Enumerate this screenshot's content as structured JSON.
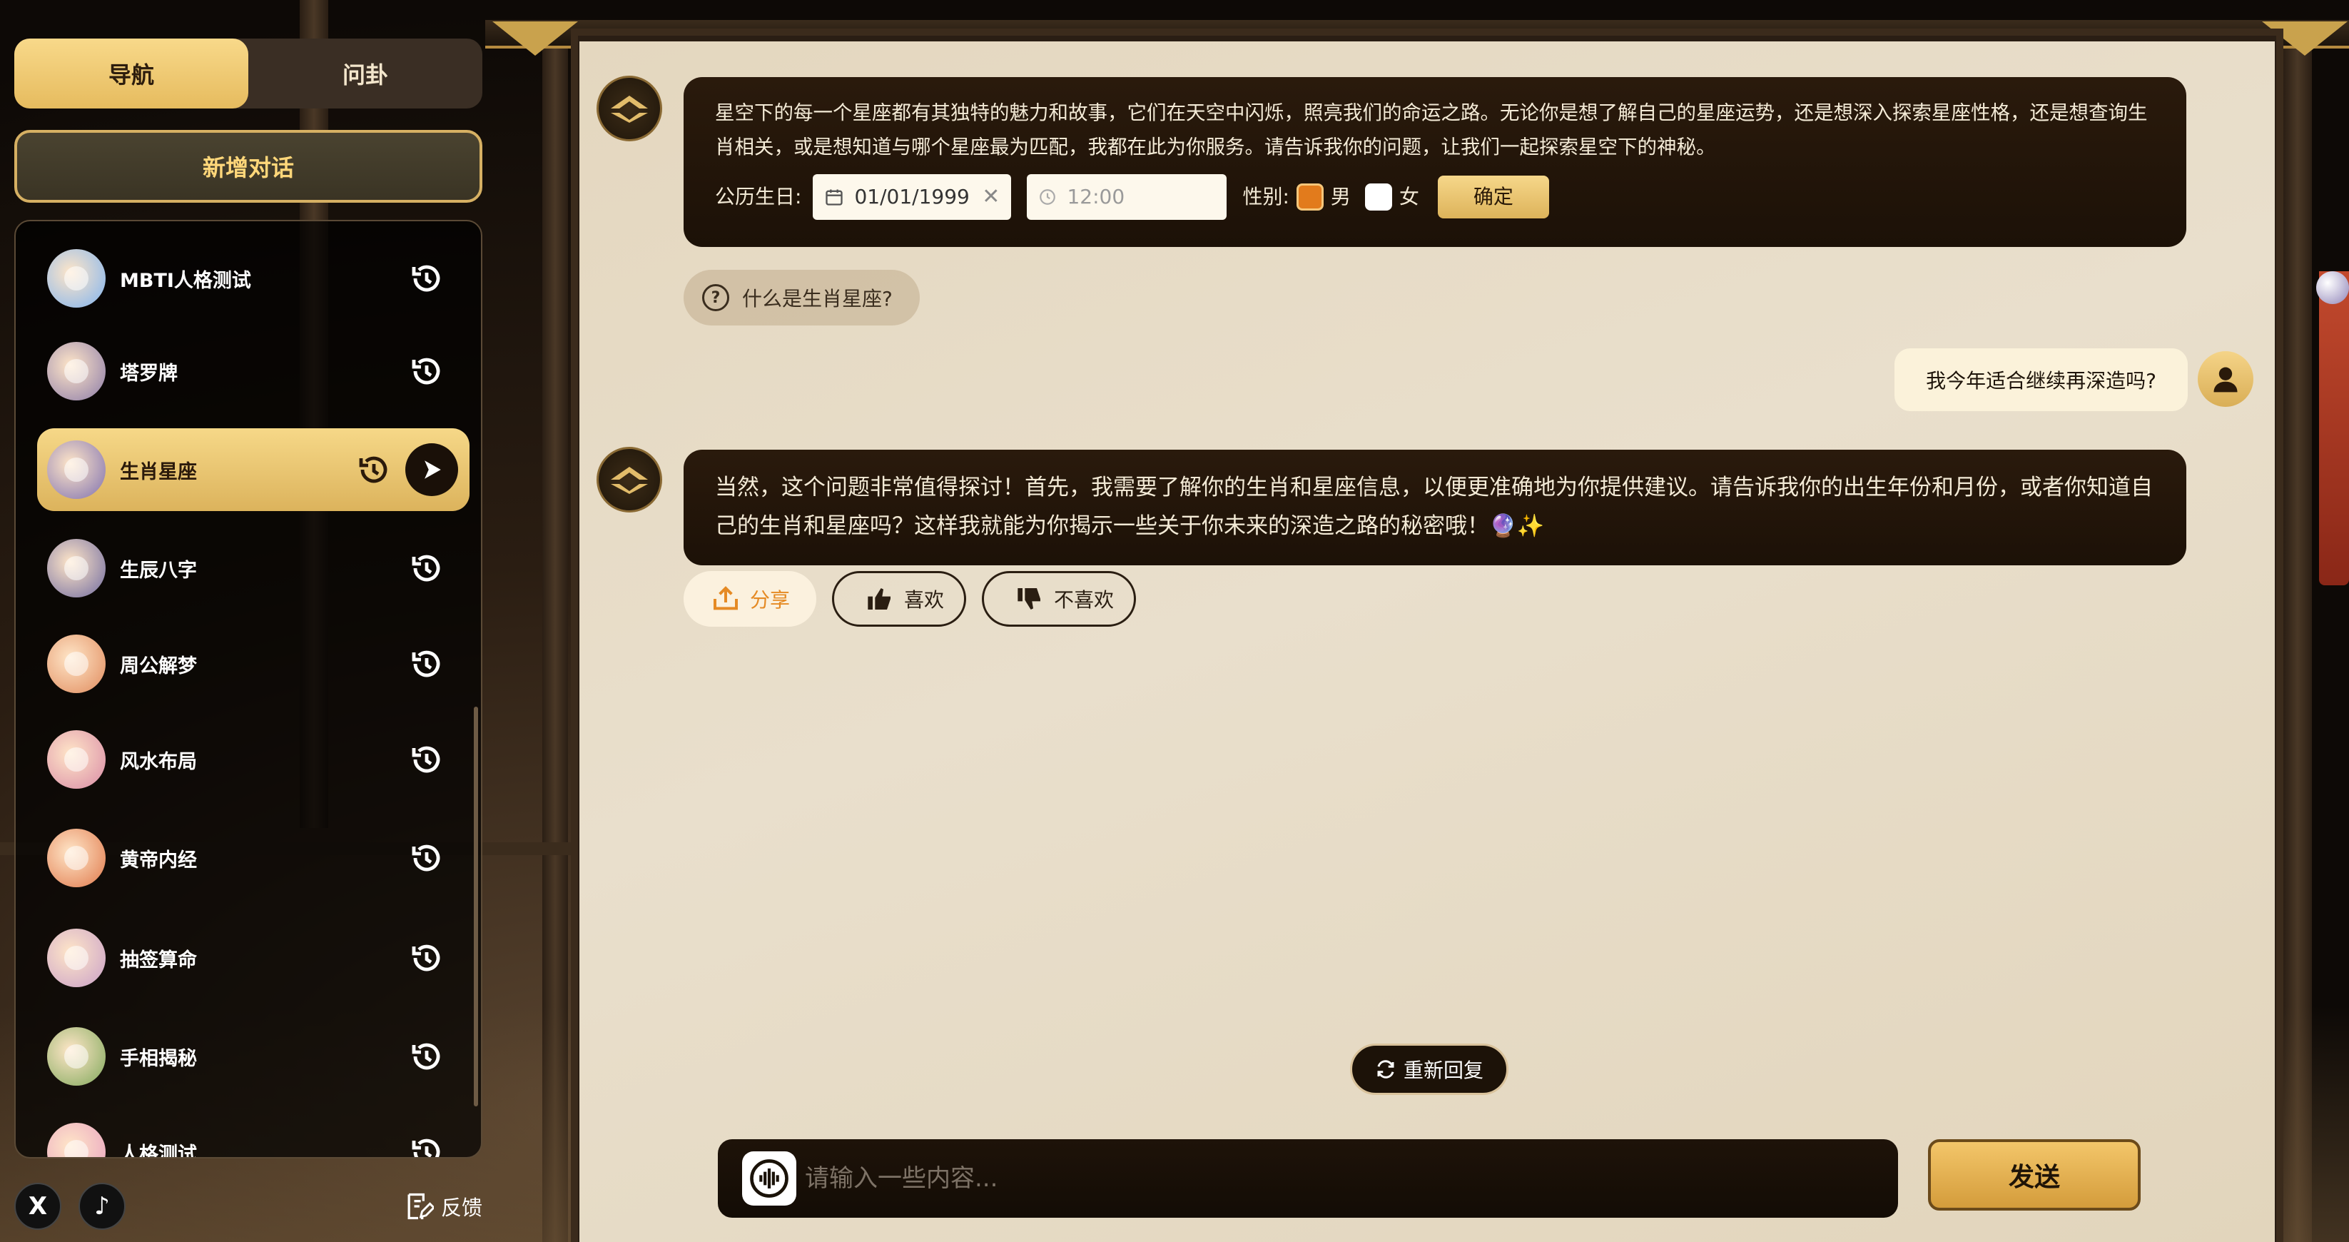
{
  "nav": {
    "tabs": [
      {
        "label": "导航",
        "active": true
      },
      {
        "label": "问卦",
        "active": false
      }
    ],
    "new_chat_label": "新增对话",
    "apps": [
      {
        "label": "MBTI人格测试",
        "active": false,
        "avatar_color": "#7fb3f0"
      },
      {
        "label": "塔罗牌",
        "active": false,
        "avatar_color": "#8a7aa8"
      },
      {
        "label": "生肖星座",
        "active": true,
        "avatar_color": "#7d6fb0"
      },
      {
        "label": "生辰八字",
        "active": false,
        "avatar_color": "#6f6aa0"
      },
      {
        "label": "周公解梦",
        "active": false,
        "avatar_color": "#e08a5c"
      },
      {
        "label": "风水布局",
        "active": false,
        "avatar_color": "#d98aa6"
      },
      {
        "label": "黄帝内经",
        "active": false,
        "avatar_color": "#e0784a"
      },
      {
        "label": "抽签算命",
        "active": false,
        "avatar_color": "#c9a0c8"
      },
      {
        "label": "手相揭秘",
        "active": false,
        "avatar_color": "#7fa85a"
      },
      {
        "label": "人格测试",
        "active": false,
        "avatar_color": "#e8a0c0"
      }
    ],
    "footer": {
      "x_icon": "X",
      "tiktok_icon": "♪",
      "feedback_label": "反馈"
    }
  },
  "chat": {
    "intro_message": "星空下的每一个星座都有其独特的魅力和故事，它们在天空中闪烁，照亮我们的命运之路。无论你是想了解自己的星座运势，还是想深入探索星座性格，还是想查询生肖相关，或是想知道与哪个星座最为匹配，我都在此为你服务。请告诉我你的问题，让我们一起探索星空下的神秘。",
    "form": {
      "birthday_label": "公历生日:",
      "date_value": "01/01/1999",
      "time_placeholder": "12:00",
      "gender_label": "性别:",
      "male_label": "男",
      "female_label": "女",
      "confirm_label": "确定"
    },
    "suggestion": "什么是生肖星座?",
    "user_message": "我今年适合继续再深造吗?",
    "bot_reply": "当然，这个问题非常值得探讨！首先，我需要了解你的生肖和星座信息，以便更准确地为你提供建议。请告诉我你的出生年份和月份，或者你知道自己的生肖和星座吗？这样我就能为你揭示一些关于你未来的深造之路的秘密哦！🔮✨",
    "actions": {
      "share_label": "分享",
      "like_label": "喜欢",
      "dislike_label": "不喜欢"
    },
    "regenerate_label": "重新回复",
    "input_placeholder": "请输入一些内容...",
    "send_label": "发送"
  },
  "colors": {
    "accent_gold": "#e6bb5e",
    "share_orange": "#e58a24",
    "checkbox_orange": "#e27b1c"
  }
}
